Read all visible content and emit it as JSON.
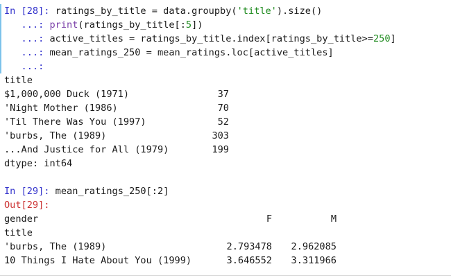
{
  "cell28": {
    "prompt_in": "In [28]: ",
    "cont": "   ...: ",
    "line1_a": "ratings_by_title = data.groupby(",
    "line1_str": "'title'",
    "line1_b": ").size()",
    "line2_fn": "print",
    "line2_b": "(ratings_by_title[:",
    "line2_num": "5",
    "line2_c": "])",
    "line3_a": "active_titles = ratings_by_title.index[ratings_by_title>=",
    "line3_num": "250",
    "line3_b": "]",
    "line4": "mean_ratings_250 = mean_ratings.loc[active_titles]",
    "line5": "",
    "output": {
      "header": "title",
      "rows": [
        {
          "title": "$1,000,000 Duck (1971)",
          "count": "37"
        },
        {
          "title": "'Night Mother (1986)",
          "count": "70"
        },
        {
          "title": "'Til There Was You (1997)",
          "count": "52"
        },
        {
          "title": "'burbs, The (1989)",
          "count": "303"
        },
        {
          "title": "...And Justice for All (1979)",
          "count": "199"
        }
      ],
      "dtype": "dtype: int64"
    }
  },
  "cell29": {
    "prompt_in": "In [29]: ",
    "code": "mean_ratings_250[:2]",
    "prompt_out": "Out[29]:",
    "col_header_label": "gender",
    "col_f": "F",
    "col_m": "M",
    "index_label": "title",
    "rows": [
      {
        "title": "'burbs, The (1989)",
        "f": "2.793478",
        "m": "2.962085"
      },
      {
        "title": "10 Things I Hate About You (1999)",
        "f": "3.646552",
        "m": "3.311966"
      }
    ]
  },
  "colors": {
    "prompt_in": "#3333cc",
    "prompt_out": "#cc3333",
    "string": "#1d8a1d",
    "builtin": "#7a3fa8",
    "active_border": "#7cc2ea"
  }
}
